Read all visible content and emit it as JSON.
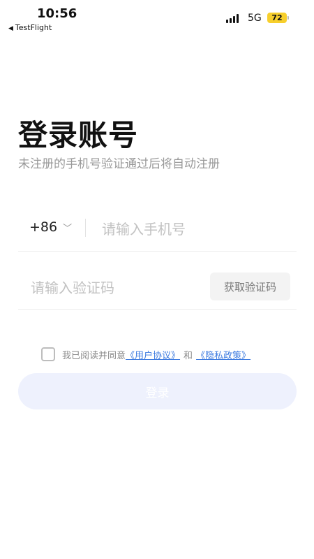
{
  "status_bar": {
    "time": "10:56",
    "back_app": "TestFlight",
    "network": "5G",
    "battery": "72",
    "battery_color": "#f7cf2c"
  },
  "header": {
    "title": "登录账号",
    "subtitle": "未注册的手机号验证通过后将自动注册"
  },
  "phone": {
    "country_code": "+86",
    "placeholder": "请输入手机号"
  },
  "code": {
    "placeholder": "请输入验证码",
    "get_code_label": "获取验证码"
  },
  "agreement": {
    "prefix": "我已阅读并同意",
    "user_agreement": "《用户协议》",
    "conjunction": "和",
    "privacy_policy": "《隐私政策》",
    "link_color": "#3d7be0"
  },
  "login": {
    "label": "登录",
    "bg_color": "#eef1fd"
  }
}
